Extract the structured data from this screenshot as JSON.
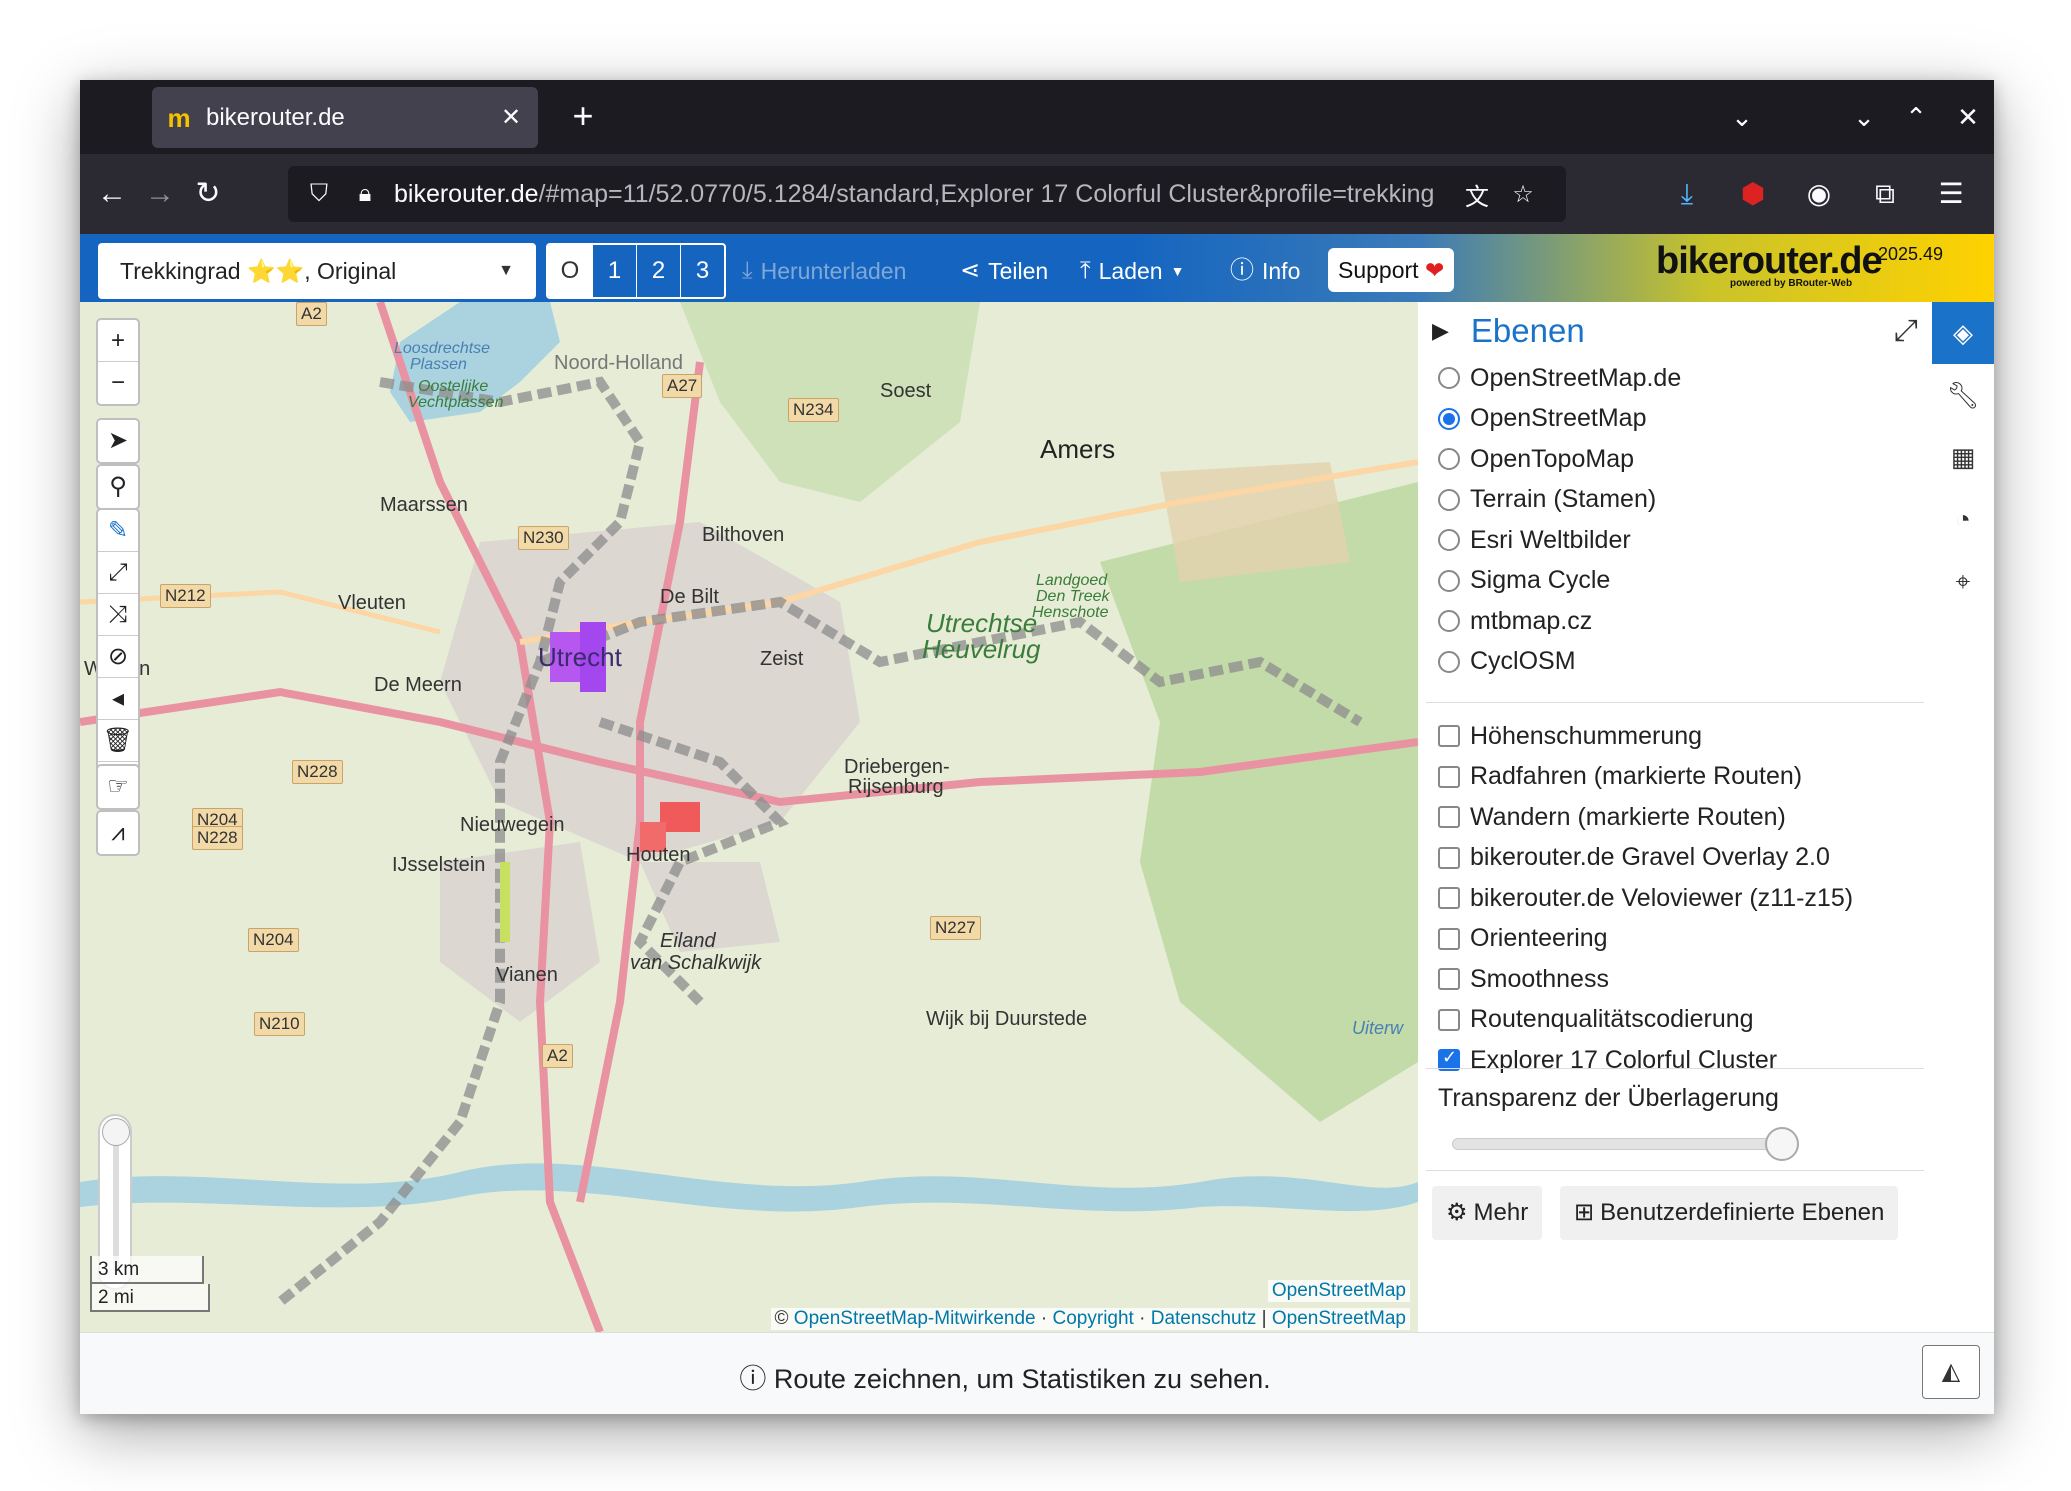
{
  "browser": {
    "tab_title": "bikerouter.de",
    "url_host": "bikerouter.de",
    "url_path": "/#map=11/52.0770/5.1284/standard,Explorer 17 Colorful Cluster&profile=trekking"
  },
  "toolbar": {
    "profile": "Trekkingrad ⭐⭐, Original",
    "alternatives": [
      "O",
      "1",
      "2",
      "3"
    ],
    "download_label": "Herunterladen",
    "share_label": "Teilen",
    "load_label": "Laden",
    "info_label": "Info",
    "support_label": "Support",
    "brand": "bikerouter.de",
    "brand_sub": "powered by BRouter-Web",
    "version": "2025.49"
  },
  "map": {
    "labels": {
      "utrecht": "Utrecht",
      "maarssen": "Maarssen",
      "vleuten": "Vleuten",
      "de_meern": "De Meern",
      "bilthoven": "Bilthoven",
      "de_bilt": "De Bilt",
      "zeist": "Zeist",
      "soest": "Soest",
      "amersfoort": "Amers",
      "nieuwegein": "Nieuwegein",
      "ijsselstein": "IJsselstein",
      "houten": "Houten",
      "vianen": "Vianen",
      "driebergen": "Driebergen-",
      "rijsenburg": "Rijsenburg",
      "eiland1": "Eiland",
      "eiland2": "van Schalkwijk",
      "wijk": "Wijk bij Duurstede",
      "heuvelrug1": "Utrechtse",
      "heuvelrug2": "Heuvelrug",
      "noord_holland": "Noord-Holland",
      "loosdrecht1": "Loosdrechtse",
      "loosdrecht2": "Plassen",
      "oostelijke1": "Oostelijke",
      "oostelijke2": "Vechtplassen",
      "landgoed1": "Landgoed",
      "landgoed2": "Den Treek",
      "landgoed3": "Henschote",
      "en": "en",
      "w": "W",
      "uiterw": "Uiterw"
    },
    "shields": {
      "a2_top": "A2",
      "a27": "A27",
      "n234": "N234",
      "n230": "N230",
      "n212": "N212",
      "n228": "N228",
      "n204_228a": "N204",
      "n204_228b": "N228",
      "n204": "N204",
      "n210": "N210",
      "n227": "N227",
      "a2_bottom": "A2"
    },
    "zoom_in": "+",
    "zoom_out": "−",
    "scale_km": "3 km",
    "scale_mi": "2 mi",
    "osm_tag": "OpenStreetMap",
    "attribution": {
      "copy": "©",
      "osm_contrib": "OpenStreetMap-Mitwirkende",
      "copyright": "Copyright",
      "privacy": "Datenschutz",
      "osm": "OpenStreetMap",
      "dot": "·",
      "bar": "|"
    }
  },
  "sidebar": {
    "title": "Ebenen",
    "base_layers": [
      {
        "label": "OpenStreetMap.de",
        "selected": false
      },
      {
        "label": "OpenStreetMap",
        "selected": true
      },
      {
        "label": "OpenTopoMap",
        "selected": false
      },
      {
        "label": "Terrain (Stamen)",
        "selected": false
      },
      {
        "label": "Esri Weltbilder",
        "selected": false
      },
      {
        "label": "Sigma Cycle",
        "selected": false
      },
      {
        "label": "mtbmap.cz",
        "selected": false
      },
      {
        "label": "CyclOSM",
        "selected": false
      }
    ],
    "overlays": [
      {
        "label": "Höhenschummerung",
        "checked": false
      },
      {
        "label": "Radfahren (markierte Routen)",
        "checked": false
      },
      {
        "label": "Wandern (markierte Routen)",
        "checked": false
      },
      {
        "label": "bikerouter.de Gravel Overlay 2.0",
        "checked": false
      },
      {
        "label": "bikerouter.de Veloviewer (z11-z15)",
        "checked": false
      },
      {
        "label": "Orienteering",
        "checked": false
      },
      {
        "label": "Smoothness",
        "checked": false
      },
      {
        "label": "Routenqualitätscodierung",
        "checked": false
      },
      {
        "label": "Explorer 17 Colorful Cluster",
        "checked": true
      }
    ],
    "transparency_label": "Transparenz der Überlagerung",
    "transparency_value": 0.93,
    "more_label": "Mehr",
    "custom_layers_label": "Benutzerdefinierte Ebenen"
  },
  "status": {
    "message": "Route zeichnen, um Statistiken zu sehen."
  }
}
